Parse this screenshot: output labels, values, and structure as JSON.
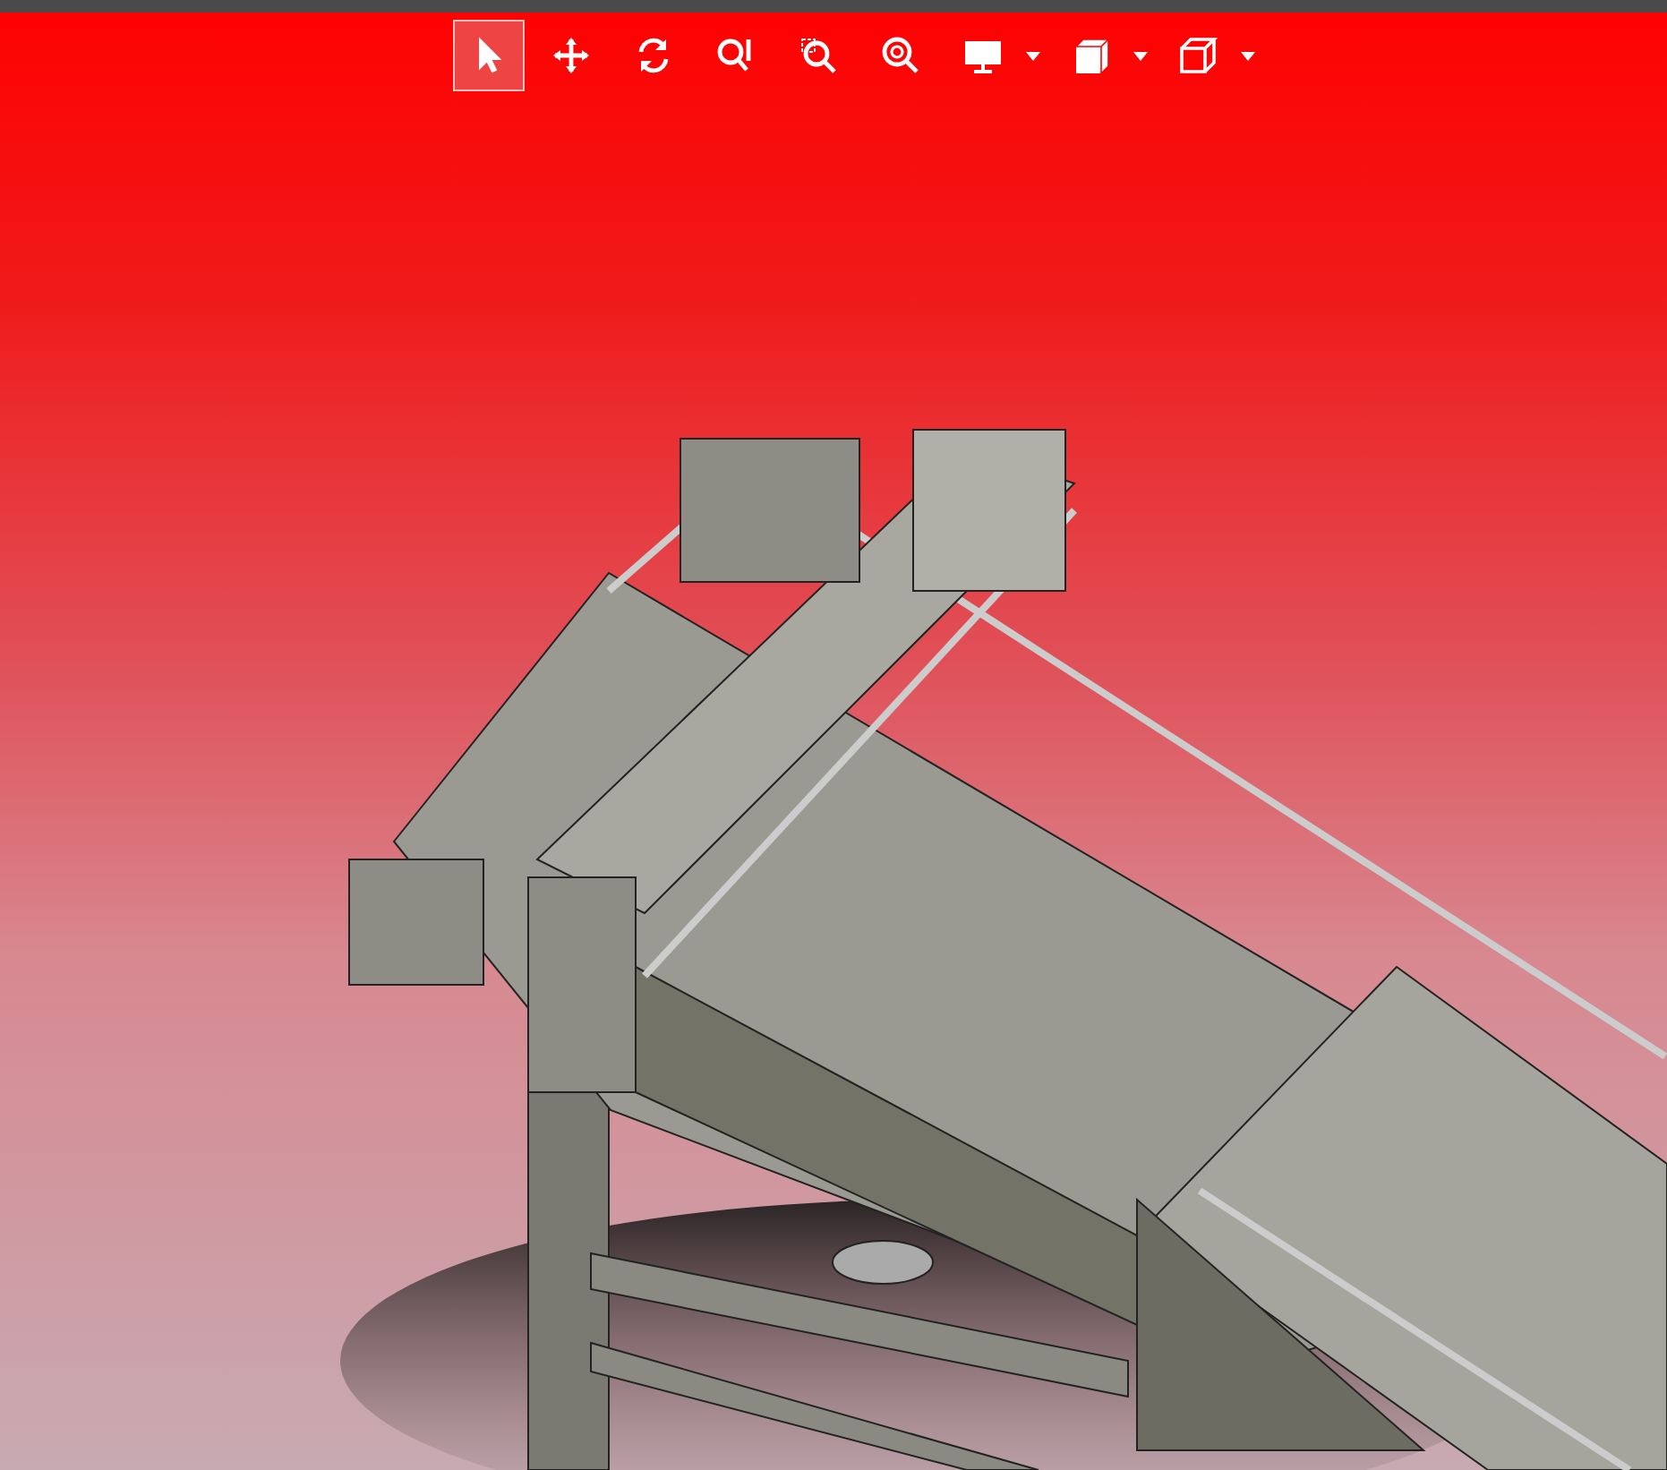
{
  "toolbar": {
    "tools": [
      {
        "kind": "select",
        "selected": true,
        "dropdown": false
      },
      {
        "kind": "pan",
        "selected": false,
        "dropdown": false
      },
      {
        "kind": "rotate",
        "selected": false,
        "dropdown": false
      },
      {
        "kind": "zoom",
        "selected": false,
        "dropdown": false
      },
      {
        "kind": "zoom-area",
        "selected": false,
        "dropdown": false
      },
      {
        "kind": "zoom-fit",
        "selected": false,
        "dropdown": false
      },
      {
        "kind": "display",
        "selected": false,
        "dropdown": true
      },
      {
        "kind": "view",
        "selected": false,
        "dropdown": true
      },
      {
        "kind": "cube",
        "selected": false,
        "dropdown": true
      }
    ]
  }
}
